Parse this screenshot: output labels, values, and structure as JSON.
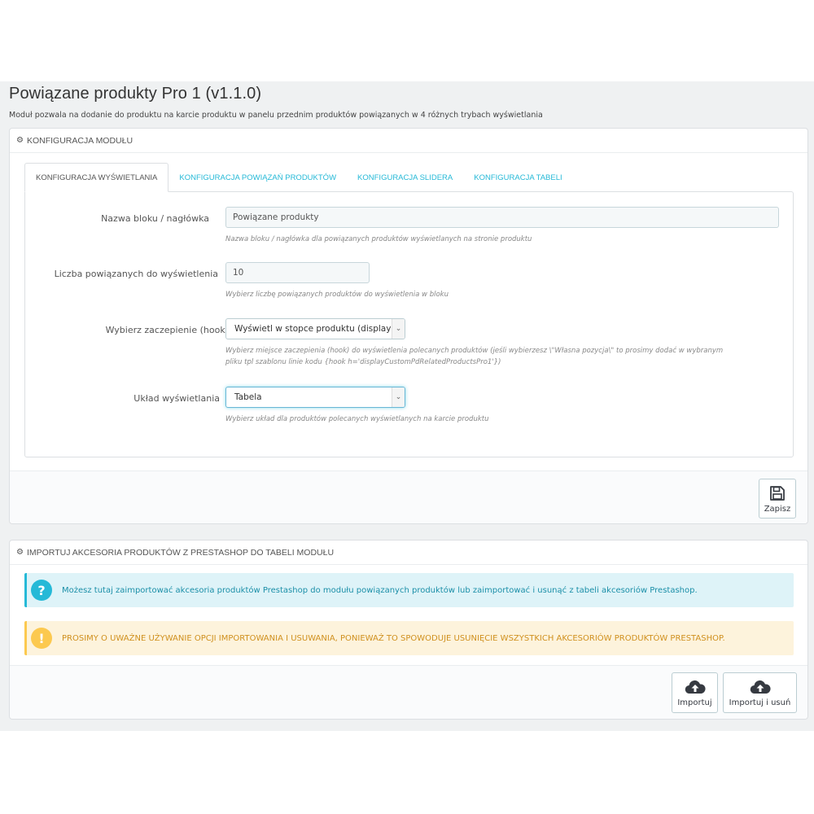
{
  "page": {
    "title": "Powiązane produkty Pro 1 (v1.1.0)",
    "description": "Moduł pozwala na dodanie do produktu na karcie produktu w panelu przednim produktów powiązanych w 4 różnych trybach wyświetlania"
  },
  "config_panel": {
    "heading": "KONFIGURACJA MODUŁU",
    "tabs": [
      {
        "label": "KONFIGURACJA WYŚWIETLANIA",
        "active": true
      },
      {
        "label": "KONFIGURACJA POWIĄZAŃ PRODUKTÓW",
        "active": false
      },
      {
        "label": "KONFIGURACJA SLIDERA",
        "active": false
      },
      {
        "label": "KONFIGURACJA TABELI",
        "active": false
      }
    ],
    "fields": {
      "block_name": {
        "label": "Nazwa bloku / nagłówka",
        "value": "Powiązane produkty",
        "help": "Nazwa bloku / nagłówka dla powiązanych produktów wyświetlanych na stronie produktu"
      },
      "count": {
        "label": "Liczba powiązanych do wyświetlenia",
        "value": "10",
        "help": "Wybierz liczbę powiązanych produktów do wyświetlenia w bloku"
      },
      "hook": {
        "label": "Wybierz zaczepienie (hook)",
        "value": "Wyświetl w stopce produktu (displayPro",
        "help_line1": "Wybierz miejsce zaczepienia (hook) do wyświetlenia polecanych produktów (jeśli wybierzesz \\\"Własna pozycja\\\" to prosimy dodać w wybranym",
        "help_line2": "pliku tpl szablonu linie kodu {hook h='displayCustomPdRelatedProductsPro1'})"
      },
      "layout": {
        "label": "Układ wyświetlania",
        "value": "Tabela",
        "help": "Wybierz układ dla produktów polecanych wyświetlanych na karcie produktu"
      }
    },
    "save_label": "Zapisz"
  },
  "import_panel": {
    "heading": "IMPORTUJ AKCESORIA PRODUKTÓW Z PRESTASHOP DO TABELI MODUŁU",
    "info_text": "Możesz tutaj zaimportować akcesoria produktów Prestashop do modułu powiązanych produktów lub zaimportować i usunąć z tabeli akcesoriów Prestashop.",
    "warning_text": "PROSIMY O UWAŻNE UŻYWANIE OPCJI IMPORTOWANIA I USUWANIA, PONIEWAŻ TO SPOWODUJE USUNIĘCIE WSZYSTKICH AKCESORIÓW PRODUKTÓW PRESTASHOP.",
    "info_glyph": "?",
    "warning_glyph": "!",
    "import_label": "Importuj",
    "import_delete_label": "Importuj i usuń"
  },
  "icons": {
    "heading": "cogs-icon",
    "save": "floppy-disk-icon",
    "import": "cloud-upload-icon",
    "select_arrow": "chevron-down-icon"
  },
  "colors": {
    "accent": "#25b9d7",
    "info_bg": "#def3f8",
    "warning_bg": "#fdf3dc",
    "warning_accent": "#fcc94f"
  }
}
